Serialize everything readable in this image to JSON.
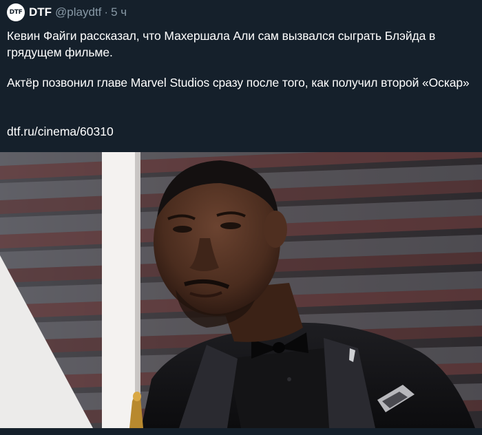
{
  "tweet": {
    "avatar_text": "DTF",
    "display_name": "DTF",
    "handle": "@playdtf",
    "separator": "·",
    "timestamp": "5 ч",
    "paragraph_1": "Кевин Файги рассказал, что Махершала Али сам вызвался сыграть Блэйда в грядущем фильме.",
    "paragraph_2": "Актёр позвонил главе Marvel Studios сразу после того, как получил второй «Оскар»",
    "link": "dtf.ru/cinema/60310"
  },
  "colors": {
    "background": "#15202b",
    "text": "#ffffff",
    "muted": "#8899a6"
  }
}
